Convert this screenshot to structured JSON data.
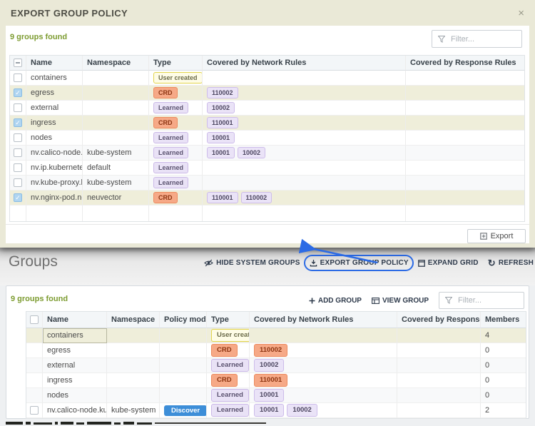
{
  "modal": {
    "title": "EXPORT GROUP POLICY",
    "close_glyph": "×",
    "count_text": "9 groups found",
    "filter_placeholder": "Filter...",
    "columns": [
      "Name",
      "Namespace",
      "Type",
      "Covered by Network Rules",
      "Covered by Response Rules"
    ],
    "rows": [
      {
        "name": "containers",
        "namespace": "",
        "type": {
          "label": "User created",
          "style": "user"
        },
        "network_rules": [],
        "response_rules": [],
        "checked": false,
        "highlighted": false
      },
      {
        "name": "egress",
        "namespace": "",
        "type": {
          "label": "CRD",
          "style": "crd"
        },
        "network_rules": [
          "110002"
        ],
        "response_rules": [],
        "checked": true,
        "highlighted": true
      },
      {
        "name": "external",
        "namespace": "",
        "type": {
          "label": "Learned",
          "style": "learned"
        },
        "network_rules": [
          "10002"
        ],
        "response_rules": [],
        "checked": false,
        "highlighted": false
      },
      {
        "name": "ingress",
        "namespace": "",
        "type": {
          "label": "CRD",
          "style": "crd"
        },
        "network_rules": [
          "110001"
        ],
        "response_rules": [],
        "checked": true,
        "highlighted": true
      },
      {
        "name": "nodes",
        "namespace": "",
        "type": {
          "label": "Learned",
          "style": "learned"
        },
        "network_rules": [
          "10001"
        ],
        "response_rules": [],
        "checked": false,
        "highlighted": false
      },
      {
        "name": "nv.calico-node.kub",
        "namespace": "kube-system",
        "type": {
          "label": "Learned",
          "style": "learned"
        },
        "network_rules": [
          "10001",
          "10002"
        ],
        "response_rules": [],
        "checked": false,
        "highlighted": false
      },
      {
        "name": "nv.ip.kubernetes.d",
        "namespace": "default",
        "type": {
          "label": "Learned",
          "style": "learned"
        },
        "network_rules": [],
        "response_rules": [],
        "checked": false,
        "highlighted": false
      },
      {
        "name": "nv.kube-proxy.kub",
        "namespace": "kube-system",
        "type": {
          "label": "Learned",
          "style": "learned"
        },
        "network_rules": [],
        "response_rules": [],
        "checked": false,
        "highlighted": false
      },
      {
        "name": "nv.nginx-pod.neuv",
        "namespace": "neuvector",
        "type": {
          "label": "CRD",
          "style": "crd"
        },
        "network_rules": [
          "110001",
          "110002"
        ],
        "response_rules": [],
        "checked": true,
        "highlighted": true
      }
    ],
    "export_button": {
      "label": "Export"
    }
  },
  "page": {
    "title": "Groups",
    "toolbar": [
      {
        "label": "HIDE SYSTEM GROUPS",
        "icon": "eye-slash-icon",
        "annotated": false
      },
      {
        "label": "EXPORT GROUP POLICY",
        "icon": "download-icon",
        "annotated": true
      },
      {
        "label": "EXPAND GRID",
        "icon": "expand-grid-icon",
        "annotated": false
      },
      {
        "label": "REFRESH",
        "icon": "refresh-icon",
        "annotated": false
      }
    ],
    "count_text": "9 groups found",
    "add_group_label": "ADD GROUP",
    "view_group_label": "VIEW GROUP",
    "filter_placeholder": "Filter...",
    "columns": [
      "Name",
      "Namespace",
      "Policy mode",
      "Type",
      "Covered by Network Rules",
      "Covered by Response R..",
      "Members"
    ],
    "rows": [
      {
        "name": "containers",
        "namespace": "",
        "policy_mode": "",
        "type": {
          "label": "User created",
          "style": "user"
        },
        "network_rules": [],
        "members": "4",
        "highlighted": true,
        "name_focused": true,
        "has_checkbox": false,
        "checked": false
      },
      {
        "name": "egress",
        "namespace": "",
        "policy_mode": "",
        "type": {
          "label": "CRD",
          "style": "crd"
        },
        "network_rules": [
          {
            "label": "110002",
            "style": "orange"
          }
        ],
        "members": "0",
        "highlighted": false,
        "name_focused": false,
        "has_checkbox": false,
        "checked": false
      },
      {
        "name": "external",
        "namespace": "",
        "policy_mode": "",
        "type": {
          "label": "Learned",
          "style": "learned"
        },
        "network_rules": [
          {
            "label": "10002",
            "style": "purple"
          }
        ],
        "members": "0",
        "highlighted": false,
        "name_focused": false,
        "has_checkbox": false,
        "checked": false
      },
      {
        "name": "ingress",
        "namespace": "",
        "policy_mode": "",
        "type": {
          "label": "CRD",
          "style": "crd"
        },
        "network_rules": [
          {
            "label": "110001",
            "style": "orange"
          }
        ],
        "members": "0",
        "highlighted": false,
        "name_focused": false,
        "has_checkbox": false,
        "checked": false
      },
      {
        "name": "nodes",
        "namespace": "",
        "policy_mode": "",
        "type": {
          "label": "Learned",
          "style": "learned"
        },
        "network_rules": [
          {
            "label": "10001",
            "style": "purple"
          }
        ],
        "members": "0",
        "highlighted": false,
        "name_focused": false,
        "has_checkbox": false,
        "checked": false
      },
      {
        "name": "nv.calico-node.kube-sys",
        "namespace": "kube-system",
        "policy_mode": "Discover",
        "type": {
          "label": "Learned",
          "style": "learned"
        },
        "network_rules": [
          {
            "label": "10001",
            "style": "purple"
          },
          {
            "label": "10002",
            "style": "purple"
          }
        ],
        "members": "2",
        "highlighted": false,
        "name_focused": false,
        "has_checkbox": true,
        "checked": false
      }
    ]
  },
  "colors": {
    "annotation_blue": "#2c6be5",
    "discover_blue": "#3d8ed8",
    "count_green": "#7d9c31",
    "highlight_row": "#efeeda",
    "crd_badge": "#f6a987",
    "learned_badge": "#e9e2f6",
    "user_badge": "#fefce6"
  }
}
